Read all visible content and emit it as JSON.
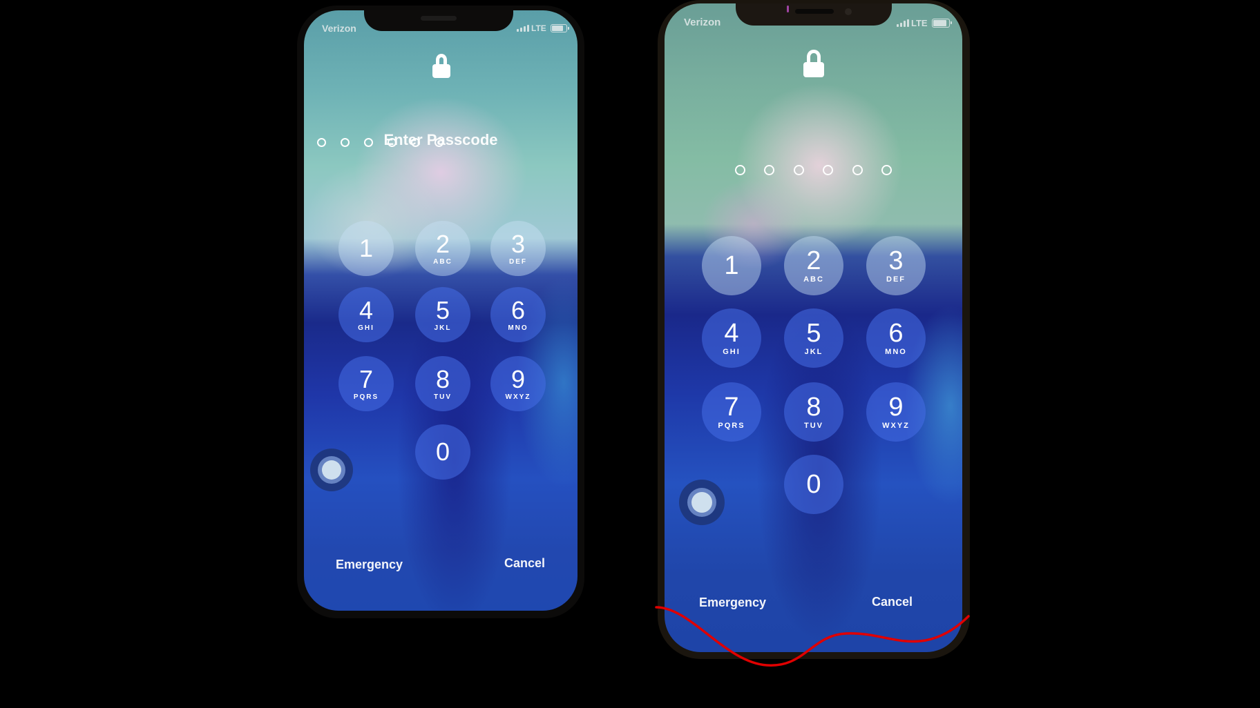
{
  "scene": {
    "description": "Photo of two iPhone lock screens side by side showing passcode entry",
    "annotation_color": "#e00000"
  },
  "phones": [
    {
      "id": "left",
      "status_bar": {
        "carrier": "Verizon",
        "network": "LTE",
        "signal_icon": "signal-bars-icon",
        "battery_icon": "battery-icon"
      },
      "lock_icon": "lock-icon",
      "prompt": "Enter Passcode",
      "passcode_length": 6,
      "passcode_entered": 0,
      "keys": [
        {
          "digit": "1",
          "letters": ""
        },
        {
          "digit": "2",
          "letters": "ABC"
        },
        {
          "digit": "3",
          "letters": "DEF"
        },
        {
          "digit": "4",
          "letters": "GHI"
        },
        {
          "digit": "5",
          "letters": "JKL"
        },
        {
          "digit": "6",
          "letters": "MNO"
        },
        {
          "digit": "7",
          "letters": "PQRS"
        },
        {
          "digit": "8",
          "letters": "TUV"
        },
        {
          "digit": "9",
          "letters": "WXYZ"
        },
        {
          "digit": "0",
          "letters": ""
        }
      ],
      "assistive_touch_icon": "assistive-touch-icon",
      "emergency_label": "Emergency",
      "cancel_label": "Cancel"
    },
    {
      "id": "right",
      "status_bar": {
        "carrier": "Verizon",
        "network": "LTE",
        "signal_icon": "signal-bars-icon",
        "battery_icon": "battery-icon"
      },
      "lock_icon": "lock-icon",
      "prompt": "",
      "passcode_length": 6,
      "passcode_entered": 0,
      "keys": [
        {
          "digit": "1",
          "letters": ""
        },
        {
          "digit": "2",
          "letters": "ABC"
        },
        {
          "digit": "3",
          "letters": "DEF"
        },
        {
          "digit": "4",
          "letters": "GHI"
        },
        {
          "digit": "5",
          "letters": "JKL"
        },
        {
          "digit": "6",
          "letters": "MNO"
        },
        {
          "digit": "7",
          "letters": "PQRS"
        },
        {
          "digit": "8",
          "letters": "TUV"
        },
        {
          "digit": "9",
          "letters": "WXYZ"
        },
        {
          "digit": "0",
          "letters": ""
        }
      ],
      "assistive_touch_icon": "assistive-touch-icon",
      "emergency_label": "Emergency",
      "cancel_label": "Cancel"
    }
  ]
}
